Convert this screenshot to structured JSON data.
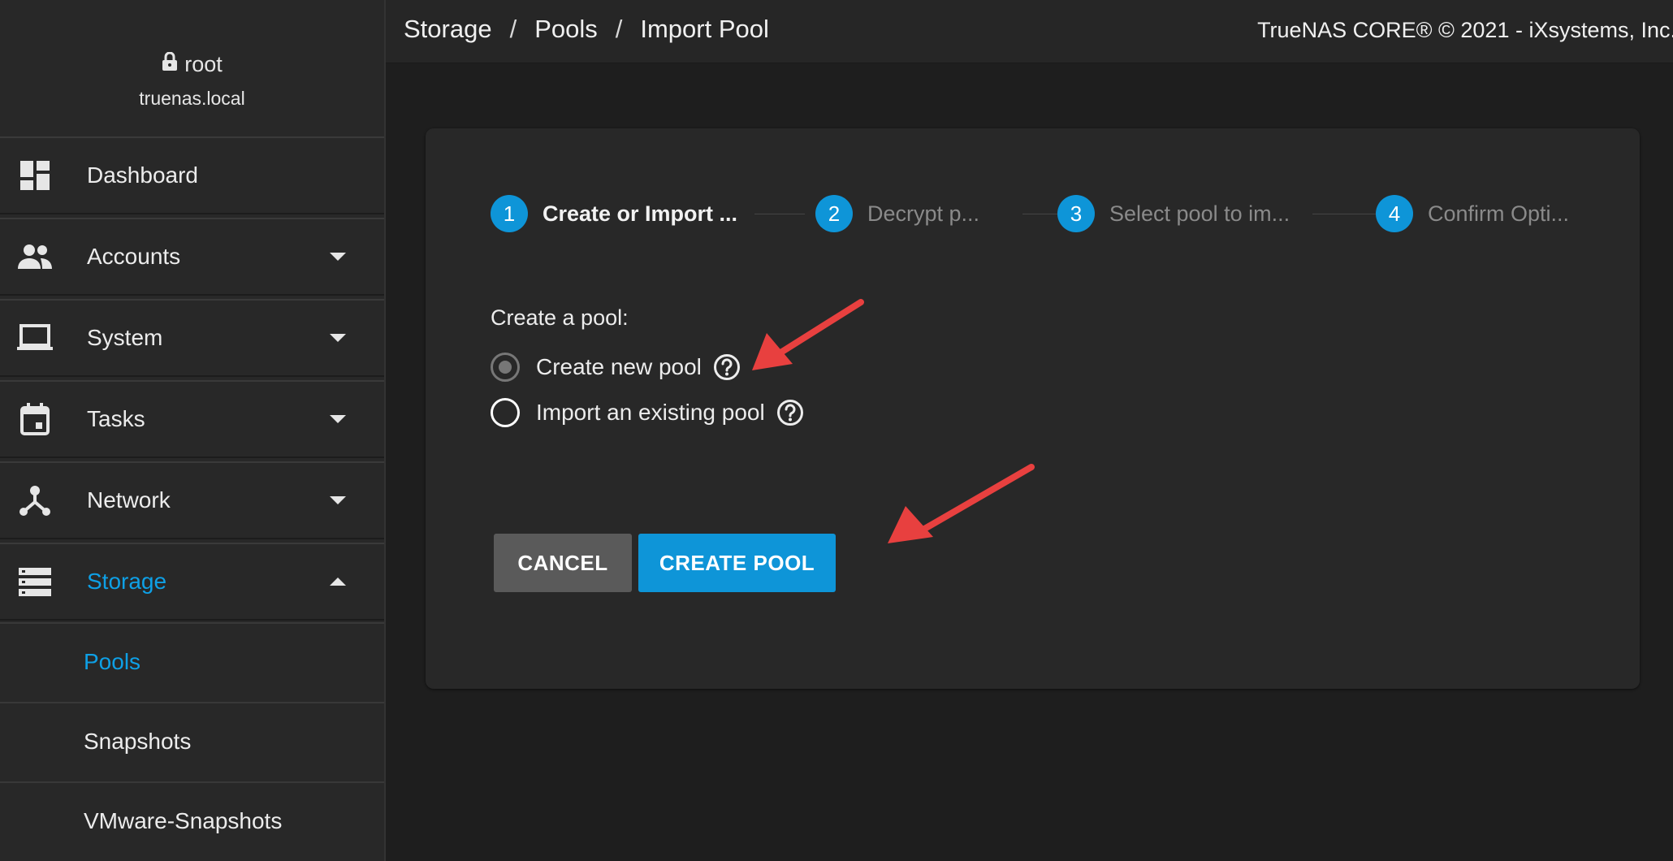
{
  "user": {
    "name": "root",
    "host": "truenas.local"
  },
  "nav": {
    "items": [
      {
        "label": "Dashboard",
        "icon": "dashboard-icon"
      },
      {
        "label": "Accounts",
        "icon": "accounts-icon"
      },
      {
        "label": "System",
        "icon": "laptop-icon"
      },
      {
        "label": "Tasks",
        "icon": "calendar-icon"
      },
      {
        "label": "Network",
        "icon": "network-icon"
      },
      {
        "label": "Storage",
        "icon": "storage-icon"
      }
    ],
    "storage_sub": [
      {
        "label": "Pools"
      },
      {
        "label": "Snapshots"
      },
      {
        "label": "VMware-Snapshots"
      }
    ]
  },
  "breadcrumb": [
    "Storage",
    "Pools",
    "Import Pool"
  ],
  "copyright": "TrueNAS CORE® © 2021 - iXsystems, Inc.",
  "stepper": [
    {
      "num": "1",
      "label": "Create or Import ..."
    },
    {
      "num": "2",
      "label": "Decrypt p..."
    },
    {
      "num": "3",
      "label": "Select pool to im..."
    },
    {
      "num": "4",
      "label": "Confirm Opti..."
    }
  ],
  "form": {
    "title": "Create a pool:",
    "options": [
      {
        "label": "Create new pool",
        "selected": true
      },
      {
        "label": "Import an existing pool",
        "selected": false
      }
    ]
  },
  "buttons": {
    "cancel": "CANCEL",
    "create": "CREATE POOL"
  },
  "colors": {
    "accent": "#0e95d8",
    "annotation": "#e8403f",
    "background": "#1e1e1e",
    "panel": "#282828"
  }
}
